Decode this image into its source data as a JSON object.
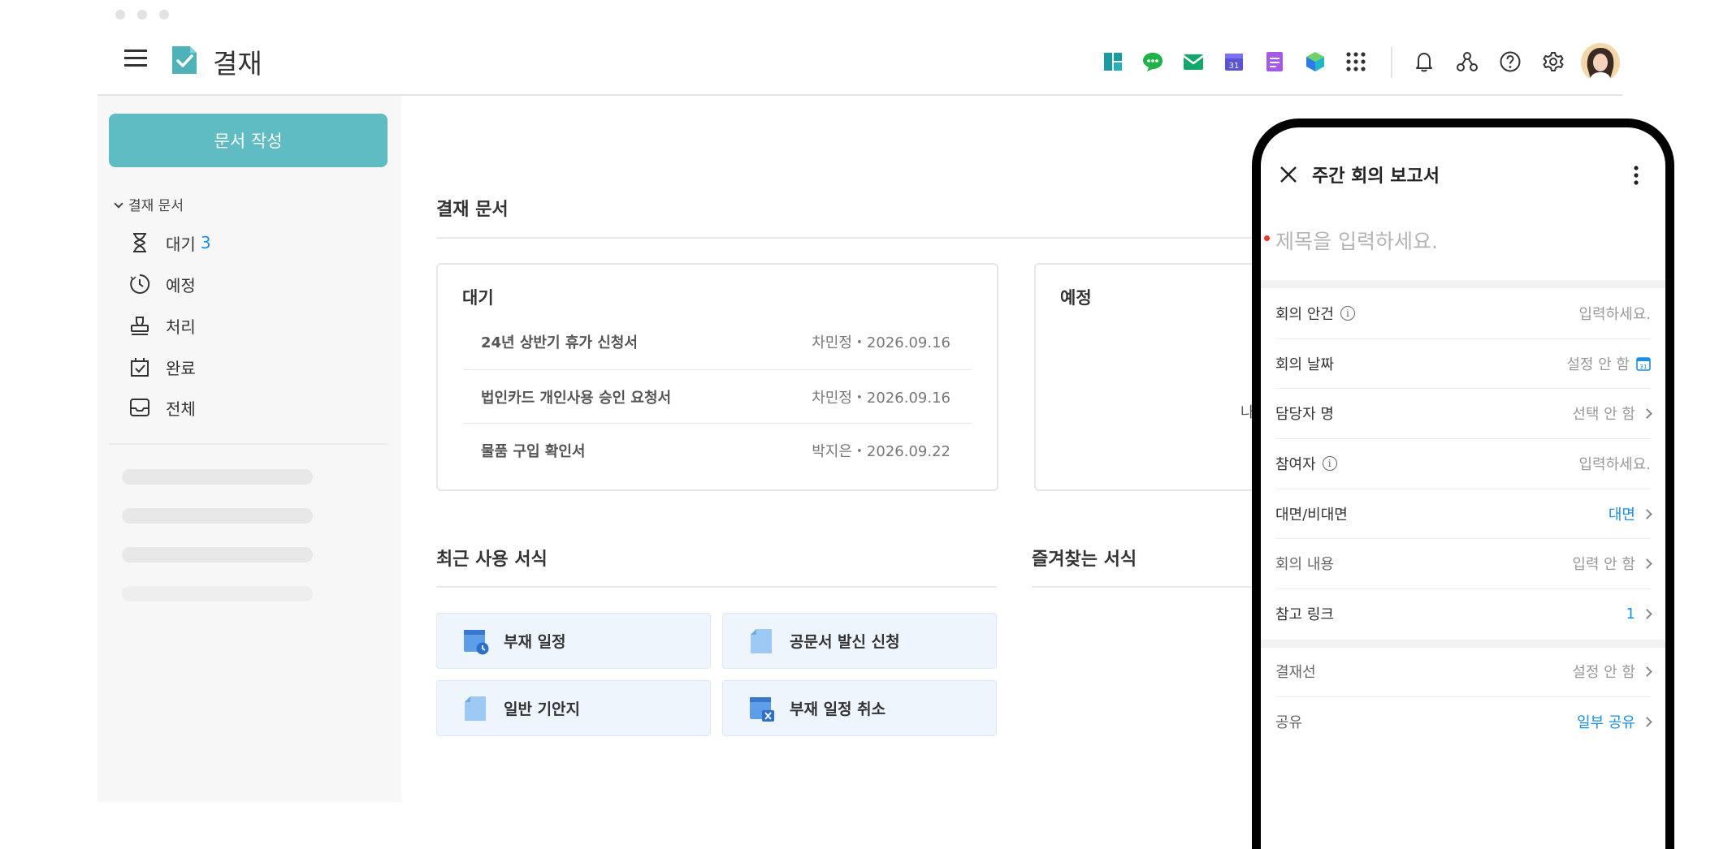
{
  "app": {
    "title": "결재"
  },
  "sidebar": {
    "write_button": "문서 작성",
    "section_label": "결재 문서",
    "items": [
      {
        "label": "대기",
        "count": "3"
      },
      {
        "label": "예정"
      },
      {
        "label": "처리"
      },
      {
        "label": "완료"
      },
      {
        "label": "전체"
      }
    ]
  },
  "main": {
    "section_title": "결재 문서",
    "pending_card": {
      "title": "대기",
      "rows": [
        {
          "title": "24년 상반기 휴가 신청서",
          "meta": "차민정・2026.09.16"
        },
        {
          "title": "법인카드 개인사용 승인 요청서",
          "meta": "차민정・2026.09.16"
        },
        {
          "title": "물품 구입 확인서",
          "meta": "박지은・2026.09.22"
        }
      ]
    },
    "scheduled_card": {
      "title": "예정",
      "partial_text": "나"
    },
    "recent_templates": {
      "title": "최근 사용 서식",
      "items": [
        "부재 일정",
        "공문서 발신 신청",
        "일반 기안지",
        "부재 일정 취소"
      ]
    },
    "favorite_templates": {
      "title": "즐겨찾는 서식"
    }
  },
  "phone": {
    "title": "주간 회의 보고서",
    "title_placeholder": "제목을 입력하세요.",
    "fields": [
      {
        "label": "회의 안건",
        "value": "입력하세요."
      },
      {
        "label": "회의 날짜",
        "value": "설정 안 함"
      },
      {
        "label": "담당자 명",
        "value": "선택 안 함"
      },
      {
        "label": "참여자",
        "value": "입력하세요."
      },
      {
        "label": "대면/비대면",
        "value": "대면"
      },
      {
        "label": "회의 내용",
        "value": "입력 안 함"
      },
      {
        "label": "참고 링크",
        "value": "1"
      }
    ],
    "approval": [
      {
        "label": "결재선",
        "value": "설정 안 함"
      },
      {
        "label": "공유",
        "value": "일부 공유"
      }
    ]
  },
  "colors": {
    "accent": "#5fbcc2",
    "link": "#1b8ee8",
    "required": "#e53935"
  },
  "icons": [
    "menu-icon",
    "approval-logo-icon",
    "board-icon",
    "chat-icon",
    "mail-icon",
    "calendar-icon",
    "note-icon",
    "cube-icon",
    "apps-grid-icon",
    "bell-icon",
    "org-chart-icon",
    "help-icon",
    "settings-icon",
    "avatar"
  ]
}
